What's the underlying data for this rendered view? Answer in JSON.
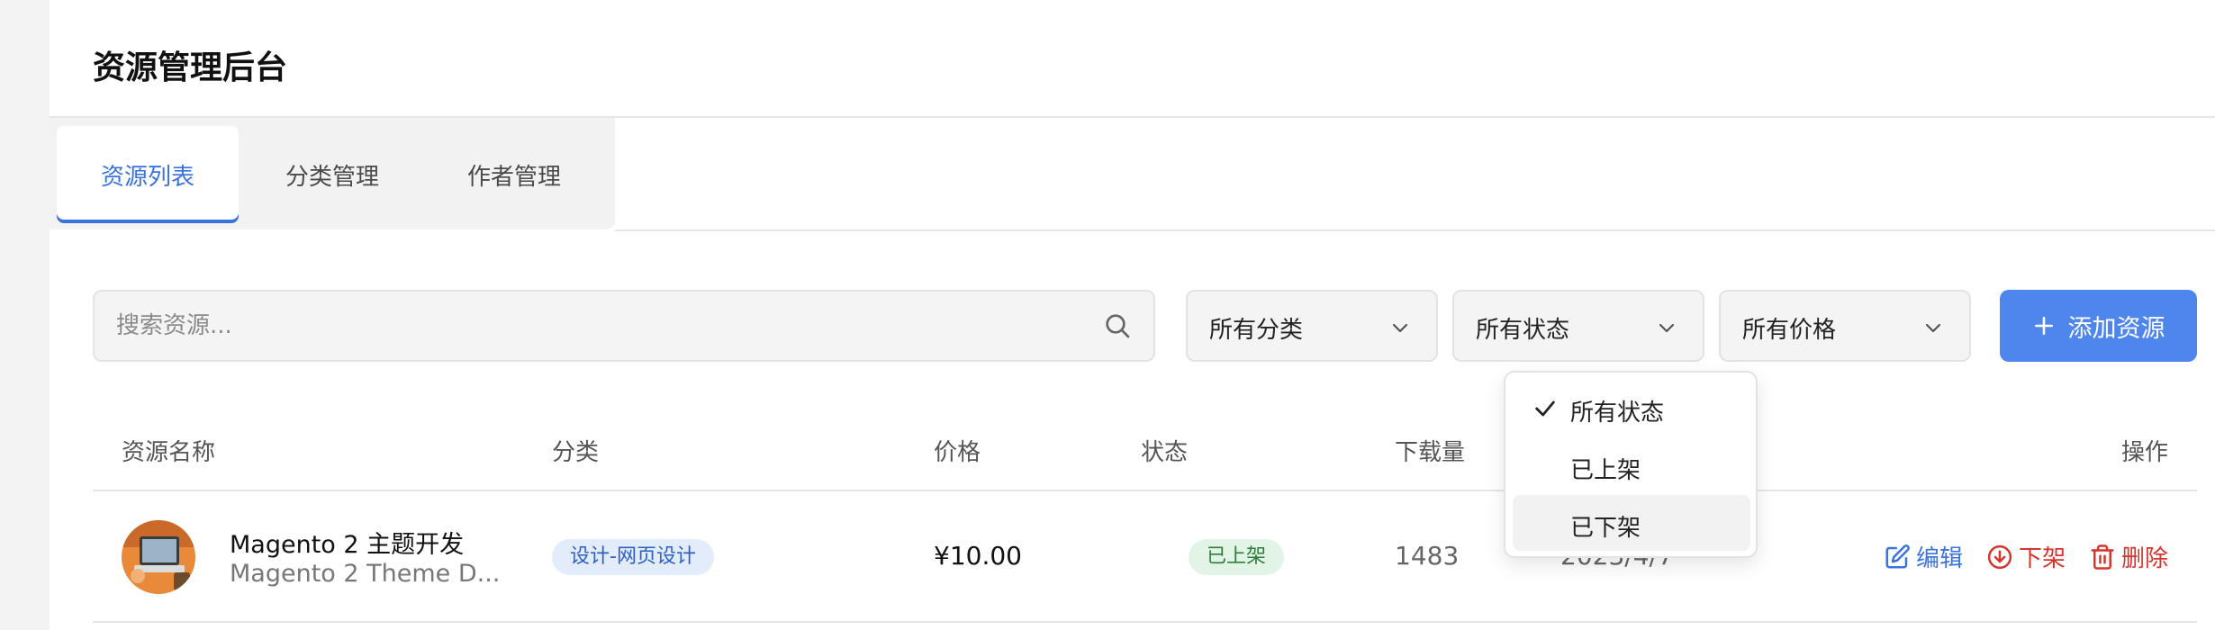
{
  "app": {
    "title": "资源管理后台"
  },
  "tabs": [
    {
      "label": "资源列表",
      "active": true
    },
    {
      "label": "分类管理",
      "active": false
    },
    {
      "label": "作者管理",
      "active": false
    }
  ],
  "toolbar": {
    "search_placeholder": "搜索资源...",
    "category_select": "所有分类",
    "status_select": "所有状态",
    "price_select": "所有价格",
    "add_label": "添加资源",
    "accent_color": "#4f86ee"
  },
  "status_dropdown": {
    "open": true,
    "options": [
      "所有状态",
      "已上架",
      "已下架"
    ],
    "selected": "所有状态",
    "hovered": "已下架"
  },
  "table": {
    "headers": {
      "name": "资源名称",
      "category": "分类",
      "price": "价格",
      "status": "状态",
      "downloads": "下载量",
      "actions": "操作"
    },
    "rows": [
      {
        "name": "Magento 2 主题开发",
        "subtitle": "Magento 2 Theme D...",
        "category": "设计-网页设计",
        "price": "¥10.00",
        "status": "已上架",
        "downloads": "1483",
        "date": "2023/4/7",
        "actions": {
          "edit": "编辑",
          "unpublish": "下架",
          "delete": "删除"
        }
      }
    ]
  }
}
